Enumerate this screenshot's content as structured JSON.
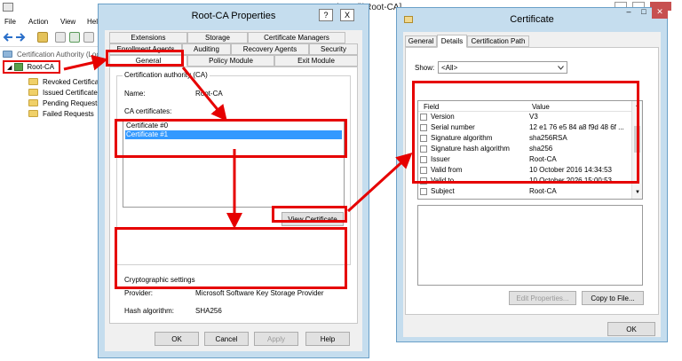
{
  "mmc": {
    "title_fragment": "y (Local)\\Root-CA]",
    "menu": [
      "File",
      "Action",
      "View",
      "Hel"
    ],
    "tree": {
      "top_item": "Certification Authority (Local)",
      "root": "Root-CA",
      "children": [
        "Revoked Certificates",
        "Issued Certificates",
        "Pending Requests",
        "Failed Requests"
      ]
    }
  },
  "root_ca_dialog": {
    "title": "Root-CA Properties",
    "controls": {
      "help": "?",
      "close": "X"
    },
    "tabs_row1": [
      "Extensions",
      "Storage",
      "Certificate Managers"
    ],
    "tabs_row2": [
      "Enrollment Agents",
      "Auditing",
      "Recovery Agents",
      "Security"
    ],
    "tabs_row3": [
      "General",
      "Policy Module",
      "Exit Module"
    ],
    "active_tab": "General",
    "group_title": "Certification authority (CA)",
    "name_label": "Name:",
    "name_value": "Root-CA",
    "ca_certs_label": "CA certificates:",
    "certificates": [
      "Certificate #0",
      "Certificate #1"
    ],
    "selected_certificate": "Certificate #1",
    "view_certificate_button": "View Certificate",
    "crypto_title": "Cryptographic settings",
    "provider_label": "Provider:",
    "provider_value": "Microsoft Software Key Storage Provider",
    "hash_label": "Hash algorithm:",
    "hash_value": "SHA256",
    "buttons": {
      "ok": "OK",
      "cancel": "Cancel",
      "apply": "Apply",
      "help": "Help"
    }
  },
  "certificate_dialog": {
    "title": "Certificate",
    "controls": {
      "minimize": "–",
      "maximize": "□",
      "close": "✕"
    },
    "tabs": [
      "General",
      "Details",
      "Certification Path"
    ],
    "active_tab": "Details",
    "show_label": "Show:",
    "show_value": "<All>",
    "columns": [
      "Field",
      "Value"
    ],
    "fields": [
      {
        "field": "Version",
        "value": "V3"
      },
      {
        "field": "Serial number",
        "value": "12 e1 76 e5 84 a8 f9d 48 6f ..."
      },
      {
        "field": "Signature algorithm",
        "value": "sha256RSA"
      },
      {
        "field": "Signature hash algorithm",
        "value": "sha256"
      },
      {
        "field": "Issuer",
        "value": "Root-CA"
      },
      {
        "field": "Valid from",
        "value": "10 October 2016 14:34:53"
      },
      {
        "field": "Valid to",
        "value": "10 October 2026 15:00:53"
      },
      {
        "field": "Subject",
        "value": "Root-CA"
      }
    ],
    "edit_properties_button": "Edit Properties...",
    "copy_to_file_button": "Copy to File...",
    "ok_button": "OK"
  },
  "colors": {
    "annotation_red": "#e60000",
    "selection_blue": "#3399ff",
    "window_frame": "#c5ddee"
  }
}
